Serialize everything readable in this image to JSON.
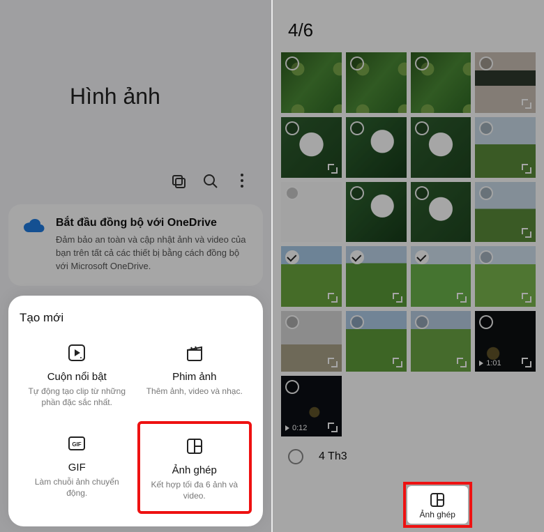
{
  "left": {
    "heading": "Hình ảnh",
    "onedrive": {
      "title": "Bắt đầu đồng bộ với OneDrive",
      "desc": "Đảm bảo an toàn và cập nhật ảnh và video của bạn trên tất cả các thiết bị bằng cách đồng bộ với Microsoft OneDrive."
    },
    "sheet_title": "Tạo mới",
    "items": [
      {
        "name": "Cuộn nổi bật",
        "desc": "Tự động tạo clip từ những phần đặc sắc nhất."
      },
      {
        "name": "Phim ảnh",
        "desc": "Thêm ảnh, video và nhạc."
      },
      {
        "name": "GIF",
        "desc": "Làm chuỗi ảnh chuyển động."
      },
      {
        "name": "Ảnh ghép",
        "desc": "Kết hợp tối đa 6 ảnh và video."
      }
    ]
  },
  "right": {
    "counter": "4/6",
    "date_label": "4 Th3",
    "collage_btn": "Ảnh ghép",
    "video_badges": {
      "v1": "1:01",
      "v2": "0:12"
    },
    "cells": [
      {
        "cls": "green-leaves",
        "checked": false,
        "expand": false
      },
      {
        "cls": "green-leaves",
        "checked": false,
        "expand": false
      },
      {
        "cls": "green-leaves",
        "checked": false,
        "expand": false
      },
      {
        "cls": "facade",
        "checked": false,
        "expand": true
      },
      {
        "cls": "orchid",
        "checked": false,
        "expand": true
      },
      {
        "cls": "orchid2",
        "checked": false,
        "expand": false
      },
      {
        "cls": "orchid",
        "checked": false,
        "expand": false
      },
      {
        "cls": "landscape",
        "checked": false,
        "expand": true
      },
      {
        "cls": "collage",
        "checked": false,
        "expand": false
      },
      {
        "cls": "orchid2",
        "checked": false,
        "expand": false
      },
      {
        "cls": "orchid",
        "checked": false,
        "expand": false
      },
      {
        "cls": "landscape",
        "checked": false,
        "expand": true
      },
      {
        "cls": "rice1",
        "checked": true,
        "expand": true
      },
      {
        "cls": "rice2",
        "checked": true,
        "expand": true
      },
      {
        "cls": "rice3",
        "checked": true,
        "expand": true
      },
      {
        "cls": "rice4",
        "checked": false,
        "expand": true
      },
      {
        "cls": "barren",
        "checked": false,
        "expand": true
      },
      {
        "cls": "greenfield",
        "checked": false,
        "expand": true
      },
      {
        "cls": "greenfield2",
        "checked": false,
        "expand": true
      },
      {
        "cls": "night",
        "checked": false,
        "expand": true,
        "video": "v1"
      },
      {
        "cls": "night2",
        "checked": false,
        "expand": true,
        "video": "v2"
      }
    ]
  }
}
